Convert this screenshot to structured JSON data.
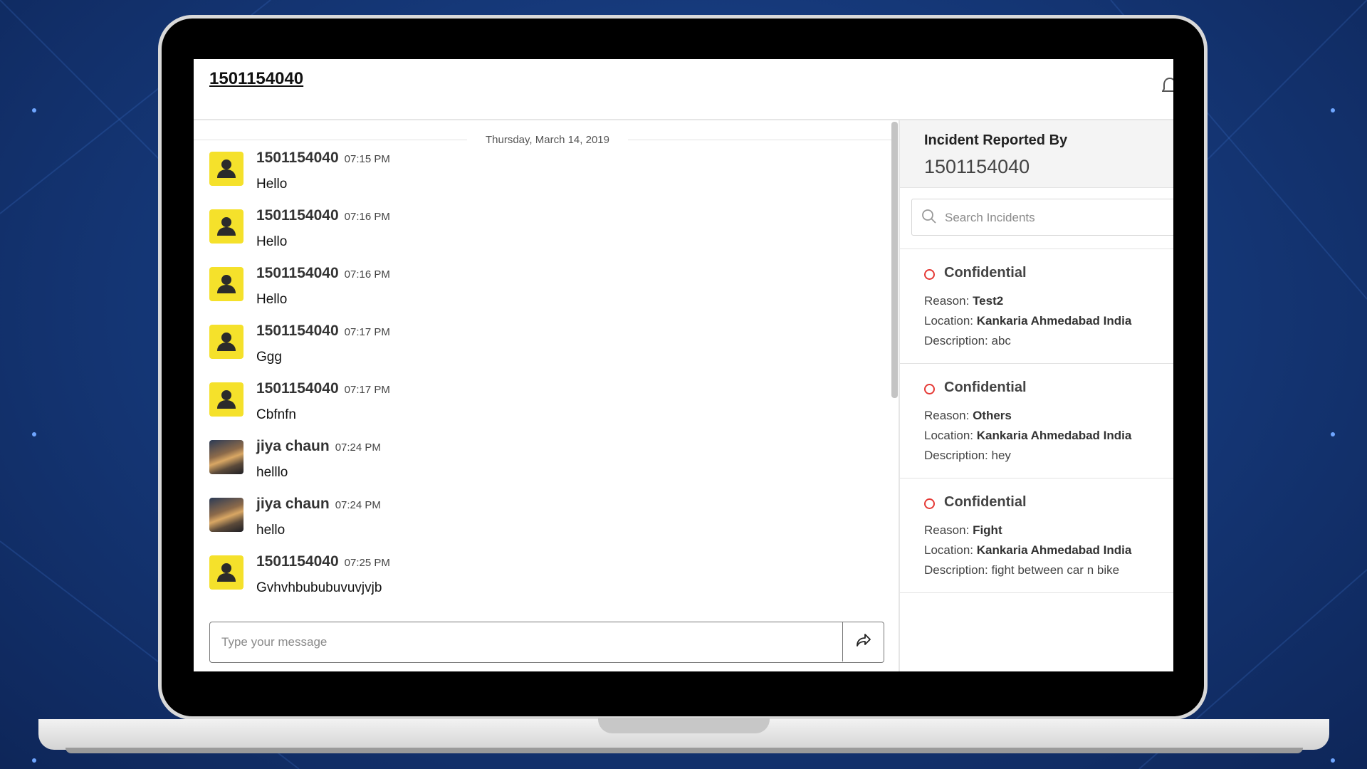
{
  "header": {
    "title": "1501154040"
  },
  "chat": {
    "date_separator": "Thursday, March 14, 2019",
    "messages": [
      {
        "sender": "1501154040",
        "time": "07:15 PM",
        "text": "Hello",
        "avatar": "default"
      },
      {
        "sender": "1501154040",
        "time": "07:16 PM",
        "text": "Hello",
        "avatar": "default"
      },
      {
        "sender": "1501154040",
        "time": "07:16 PM",
        "text": "Hello",
        "avatar": "default"
      },
      {
        "sender": "1501154040",
        "time": "07:17 PM",
        "text": "Ggg",
        "avatar": "default"
      },
      {
        "sender": "1501154040",
        "time": "07:17 PM",
        "text": "Cbfnfn",
        "avatar": "default"
      },
      {
        "sender": "jiya chaun",
        "time": "07:24 PM",
        "text": "helllo",
        "avatar": "photo"
      },
      {
        "sender": "jiya chaun",
        "time": "07:24 PM",
        "text": "hello",
        "avatar": "photo"
      },
      {
        "sender": "1501154040",
        "time": "07:25 PM",
        "text": "Gvhvhbububuvuvjvjb",
        "avatar": "default"
      }
    ],
    "compose_placeholder": "Type your message",
    "send_icon": "share-arrow-icon"
  },
  "sidebar": {
    "reporter_label": "Incident Reported By",
    "reporter_value": "1501154040",
    "search_placeholder": "Search Incidents",
    "field_labels": {
      "reason": "Reason:",
      "location": "Location:",
      "description": "Description:"
    },
    "incidents": [
      {
        "title": "Confidential",
        "reason": "Test2",
        "location": "Kankaria Ahmedabad India",
        "description": "abc"
      },
      {
        "title": "Confidential",
        "reason": "Others",
        "location": "Kankaria Ahmedabad India",
        "description": "hey"
      },
      {
        "title": "Confidential",
        "reason": "Fight",
        "location": "Kankaria Ahmedabad India",
        "description": "fight between car n bike"
      }
    ]
  },
  "colors": {
    "avatar_default": "#f5e12b",
    "status_ring": "#e53935",
    "background": "#163a7c"
  }
}
